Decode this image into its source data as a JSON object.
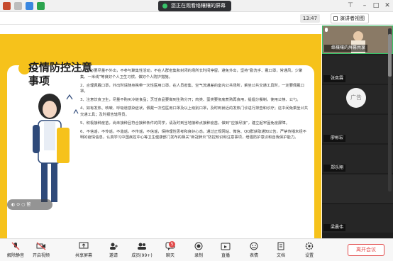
{
  "titlebar": {
    "share_status": "您正在观看络穰穰的屏幕",
    "timer": "13:47",
    "view_label": "演讲者视图"
  },
  "slide": {
    "title": "疫情防控注意事项",
    "lines": [
      "1、非必要尽量不外出，不参与聚集性活动，不在人群密集和封闭的场所长时间停留。避免外出，坚持“勤洗手、戴口罩，常通风，少聚集、一米线”等良好个人卫生习惯，做好个人防护措施。",
      "2、合理佩戴口罩，外出时请随身携带一次性医用口罩，在人员密集、空气流通差的室内公共场所，乘坐公共交通工具时，一定要佩戴口罩。",
      "3、注意饮食卫生，尽量不购买冷链食品；烹饪食品要做到生熟分开；肉类、蛋类要彻底煮熟再食用，提倡分餐制，使用公筷、公勺。",
      "4、如有发热、咳嗽、呼吸道感染症状，佩戴一次性医用口罩及以上级别口罩，及时到就近的发热门诊进行排查和诊疗；这中间免乘坐公共交通工具；及时报告辖导员。",
      "5、积极接种疫苗，尚未接种且符合接种条件的同学，请及时到当地接种点接种疫苗，做到“应接尽接”，建立起牢固免疫屏障。",
      "6、不信谣，不传谣，不造谣，不传谣，不信谣，保持理性思考和良好心态。通过正规网站、微信、QQ群获取通知公告，严禁传播未经不明的疫情信息，认真学习中国疾控中心等卫生健康部门发布的相关“新冠肺炎”防控知识和注意事项，增强防护意识和自我保护能力。"
    ],
    "controls_label": "◐ ⊙ ○ 留"
  },
  "participants": [
    {
      "name": "络穰穰的屏幕共享",
      "kind": "photo"
    },
    {
      "name": "张奕霖",
      "kind": "dark"
    },
    {
      "name": "广告",
      "kind": "avatar"
    },
    {
      "name": "廖彬宏",
      "kind": "dark"
    },
    {
      "name": "郑乐翔",
      "kind": "dark"
    },
    {
      "name": "",
      "kind": "blank"
    },
    {
      "name": "梁晨伟",
      "kind": "dark"
    }
  ],
  "toolbar": {
    "items": [
      {
        "label": "解除静音",
        "icon": "mic-muted-icon"
      },
      {
        "label": "开启视频",
        "icon": "video-off-icon"
      },
      {
        "label": "共享屏幕",
        "icon": "share-screen-icon"
      },
      {
        "label": "邀请",
        "icon": "invite-icon"
      },
      {
        "label": "成员(99+)",
        "icon": "members-icon"
      },
      {
        "label": "聊天",
        "icon": "chat-icon"
      },
      {
        "label": "录制",
        "icon": "record-icon"
      },
      {
        "label": "直播",
        "icon": "live-icon"
      },
      {
        "label": "表情",
        "icon": "emoji-icon"
      },
      {
        "label": "文档",
        "icon": "document-icon"
      },
      {
        "label": "设置",
        "icon": "settings-icon"
      }
    ],
    "chat_badge": "5",
    "leave_label": "离开会议"
  },
  "colors": {
    "slide_bg": "#f6c21b",
    "accent_green": "#39c36a",
    "leave_red": "#e24a4a"
  }
}
